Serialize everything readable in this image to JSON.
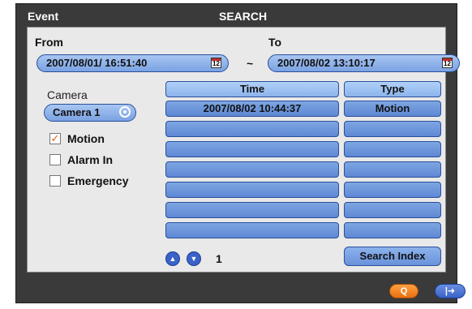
{
  "window": {
    "title": "Event",
    "heading": "SEARCH"
  },
  "range": {
    "from_label": "From",
    "to_label": "To",
    "separator": "~",
    "from_value": "2007/08/01/ 16:51:40",
    "to_value": "2007/08/02 13:10:17",
    "calendar_icon_text": "12"
  },
  "camera": {
    "label": "Camera",
    "selected": "Camera 1"
  },
  "filters": [
    {
      "label": "Motion",
      "checked": true
    },
    {
      "label": "Alarm In",
      "checked": false
    },
    {
      "label": "Emergency",
      "checked": false
    }
  ],
  "check_mark": "✓",
  "table": {
    "headers": {
      "time": "Time",
      "type": "Type"
    },
    "rows": [
      {
        "time": "2007/08/02 10:44:37",
        "type": "Motion"
      },
      {
        "time": "",
        "type": ""
      },
      {
        "time": "",
        "type": ""
      },
      {
        "time": "",
        "type": ""
      },
      {
        "time": "",
        "type": ""
      },
      {
        "time": "",
        "type": ""
      },
      {
        "time": "",
        "type": ""
      }
    ]
  },
  "pagination": {
    "up_icon": "▲",
    "down_icon": "▼",
    "page": "1"
  },
  "search_index_label": "Search Index",
  "footer": {
    "search_icon": "Q",
    "exit_icon": "|➜"
  },
  "colors": {
    "accent": "#7aa2e2",
    "header_cell": "#9cc2f2",
    "search_button": "#f08020",
    "frame": "#3a3a3a"
  }
}
